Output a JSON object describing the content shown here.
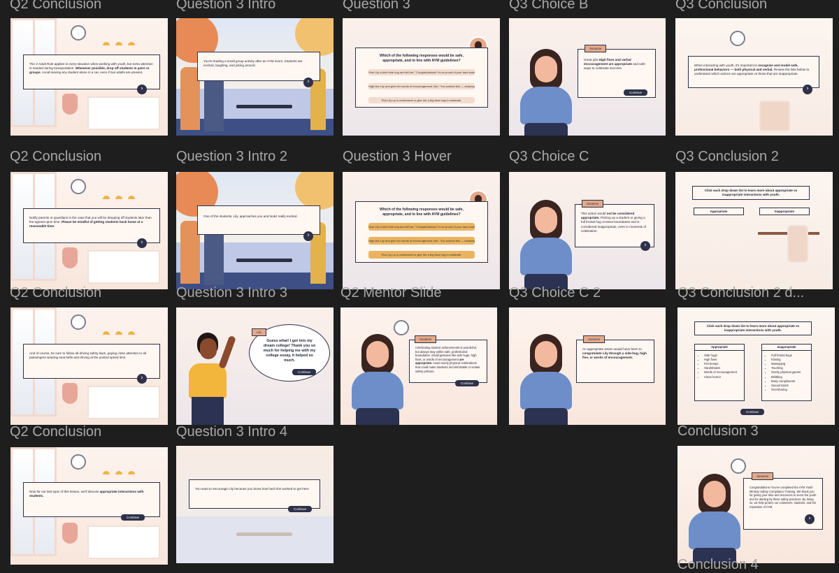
{
  "colors": {
    "canvas": "#1e1e1e",
    "label": "#a8a8a8",
    "panel_border": "#2e3148",
    "button": "#2e3148",
    "accent_peach": "#e4a989",
    "hover_option": "#e9b35f"
  },
  "icons": {
    "next": "›",
    "close": "×"
  },
  "frames": {
    "c0r0": {
      "label": "Q2 Conclusion",
      "text_a": "The 2-Adult Rule applies in every situation when working with youth, but extra attention is needed during transportation. ",
      "text_b": "Whenever possible, drop off students in pairs or groups.",
      "text_c": " Avoid leaving any student alone in a car, even if two adults are present."
    },
    "c0r1": {
      "label": "Q2 Conclusion",
      "text_a": "Notify parents or guardians in the case that you will be dropping off students later than the agreed upon time. ",
      "text_b": "Please be mindful of getting students back home at a reasonable time."
    },
    "c0r2": {
      "label": "Q2 Conclusion",
      "text_a": "And of course, be sure to follow all driving safety laws, paying close attention to all passengers wearing seat belts and driving at the posted speed limit."
    },
    "c0r3": {
      "label": "Q2 Conclusion",
      "text_a": "Now for our last topic of this lesson, we'll discuss ",
      "text_b": "appropriate interactions with students.",
      "button": "Continue"
    },
    "c1r0": {
      "label": "Question 3 Intro",
      "text_a": "You're leading a small group activity after an AYM event. Students are excited, laughing, and joking around."
    },
    "c1r1": {
      "label": "Question 3 Intro 2",
      "text_a": "One of the students, Lily, approaches you and looks really excited."
    },
    "c1r2": {
      "label": "Question 3 Intro 3",
      "name": "Lily",
      "speech": "Guess what! I got into my dream college! Thank you so much for helping me with my college essay, it helped so much.",
      "button": "Continue"
    },
    "c1r3": {
      "label": "Question 3 Intro 4",
      "text_a": "You want to encourage Lily because you know how hard she worked to get here.",
      "button": "Continue"
    },
    "c2r0": {
      "label": "Question 3",
      "title": "Which of the following responses would be safe, appropriate, and in line with AYM guidelines?",
      "options": [
        "Give Lily a brief side hug and tell her, \"Congratulations! I'm so proud of your hard work!\"",
        "High-five Lily and give her words of encouragement, like: \"You worked this — amazing job!\"",
        "Pick Lily up in excitement or give her a big bear hug to celebrate."
      ]
    },
    "c2r1": {
      "label": "Question 3 Hover",
      "title": "Which of the following responses would be safe, appropriate, and in line with AYM guidelines?",
      "options": [
        "Give Lily a brief side hug and tell her, \"Congratulations! I'm so proud of your hard work!\"",
        "High-five Lily and give her words of encouragement, like: \"You worked this — amazing job!\"",
        "Pick Lily up in excitement or give her a big bear hug to celebrate."
      ]
    },
    "c2r2": {
      "label": "Q2 Mentor Slide",
      "name": "Susanne",
      "text_a": "Celebrating student achievements is wonderful, but always stay within safe, professional boundaries. Small gestures like side hugs, high fives, or words of encouragement ",
      "text_b": "are appropriate.",
      "text_c": " Avoid overly physical celebrations that could make students uncomfortable or violate safety policies.",
      "button": "Continue"
    },
    "c3r0": {
      "label": "Q3 Choice B",
      "name": "Susanne",
      "text_a": "Great job! ",
      "text_b": "High fives and verbal encouragement are appropriate",
      "text_c": " and safe ways to celebrate success.",
      "button": "Continue"
    },
    "c3r1": {
      "label": "Q3 Choice C",
      "name": "Susanne",
      "text_a": "This action would ",
      "text_b": "not be considered appropriate.",
      "text_c": " Picking up a student or giving a full frontal hug crosses boundaries and is considered inappropriate, even in moments of celebration."
    },
    "c3r2": {
      "label": "Q3 Choice C 2",
      "name": "Susanne",
      "text_a": "An appropriate action would have been to ",
      "text_b": "congratulate Lily through a side-hug, high five, or words of encouragement."
    },
    "c4r0": {
      "label": "Q3 Conclusion",
      "text_a": "When interacting with youth, it's important to ",
      "text_b": "recognize and model safe, professional behaviors — both physical and verbal.",
      "text_c": " Review the lists below to understand which actions are appropriate vs those that are inappropriate."
    },
    "c4r1": {
      "label": "Q3 Conclusion 2",
      "title_a": "Click each drop down list to learn more about ",
      "title_b": "appropriate vs inappropriate interactions with youth.",
      "dd_left": "Appropriate",
      "dd_right": "Inappropriate"
    },
    "c4r2": {
      "label": "Q3 Conclusion 2 d...",
      "title_a": "Click each drop down list to learn more about ",
      "title_b": "appropriate vs inappropriate interactions with youth.",
      "dd_left": "Appropriate",
      "dd_right": "Inappropriate",
      "appropriate": [
        "Side hugs",
        "High fives",
        "Fist bumps",
        "Handshakes",
        "Words of encouragement",
        "Clean humor"
      ],
      "inappropriate": [
        "Full frontal hugs",
        "Kissing",
        "Massaging",
        "Touching",
        "Overly physical games",
        "Belittling",
        "Body compliments",
        "Sexual topics",
        "Oversharing"
      ],
      "button": "Continue"
    },
    "c4r3": {
      "label": "Conclusion 3",
      "name": "Susanne",
      "text_a": "Congratulations! You've completed the AYM Youth Ministry Safety Compliance Training. We thank you for giving your time and resources to serve the youth and for abiding by these safety practices. By doing so, we help protect our volunteers, students, and the reputation of AYM."
    },
    "c4r4": {
      "label": "Conclusion 4"
    }
  }
}
